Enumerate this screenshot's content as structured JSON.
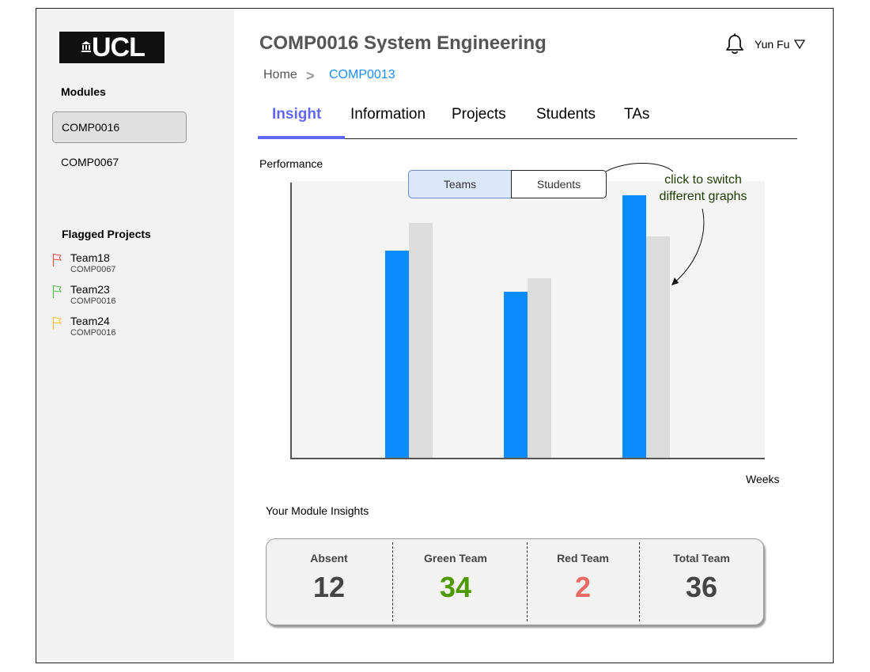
{
  "logo": {
    "text": "UCL"
  },
  "sidebar": {
    "modules_heading": "Modules",
    "modules": [
      {
        "label": "COMP0016",
        "active": true
      },
      {
        "label": "COMP0067",
        "active": false
      }
    ],
    "flagged_heading": "Flagged Projects",
    "flagged": [
      {
        "team": "Team18",
        "module": "COMP0067",
        "flag_color": "#e05252",
        "flag_icon": "flag-icon"
      },
      {
        "team": "Team23",
        "module": "COMP0016",
        "flag_color": "#5cb85c",
        "flag_icon": "flag-icon"
      },
      {
        "team": "Team24",
        "module": "COMP0016",
        "flag_color": "#f0c040",
        "flag_icon": "flag-icon"
      }
    ]
  },
  "header": {
    "title": "COMP0016 System Engineering",
    "user_name": "Yun Fu",
    "bell_icon": "bell-icon",
    "caret_icon": "chevron-down-icon"
  },
  "breadcrumb": {
    "home": "Home",
    "separator": ">",
    "current": "COMP0013"
  },
  "tabs": [
    {
      "label": "Insight",
      "active": true
    },
    {
      "label": "Information",
      "active": false
    },
    {
      "label": "Projects",
      "active": false
    },
    {
      "label": "Students",
      "active": false
    },
    {
      "label": "TAs",
      "active": false
    }
  ],
  "performance": {
    "label": "Performance",
    "toggle": {
      "teams": "Teams",
      "students": "Students",
      "selected": "Teams"
    },
    "annotation": "click to switch different graphs",
    "xlabel": "Weeks"
  },
  "chart_data": {
    "type": "bar",
    "categories": [
      "",
      "",
      ""
    ],
    "series": [
      {
        "values": [
          75,
          60,
          95
        ],
        "color": "#0a8cff"
      },
      {
        "values": [
          85,
          65,
          80
        ],
        "color": "#dcdcdc"
      }
    ],
    "xlabel": "Weeks",
    "ylabel": "",
    "ylim": [
      0,
      100
    ],
    "grid": false
  },
  "insights": {
    "label": "Your Module Insights",
    "stats": [
      {
        "label": "Absent",
        "value": "12",
        "color": "#444444"
      },
      {
        "label": "Green Team",
        "value": "34",
        "color": "#4d9a00"
      },
      {
        "label": "Red Team",
        "value": "2",
        "color": "#ea6b66"
      },
      {
        "label": "Total Team",
        "value": "36",
        "color": "#444444"
      }
    ]
  }
}
